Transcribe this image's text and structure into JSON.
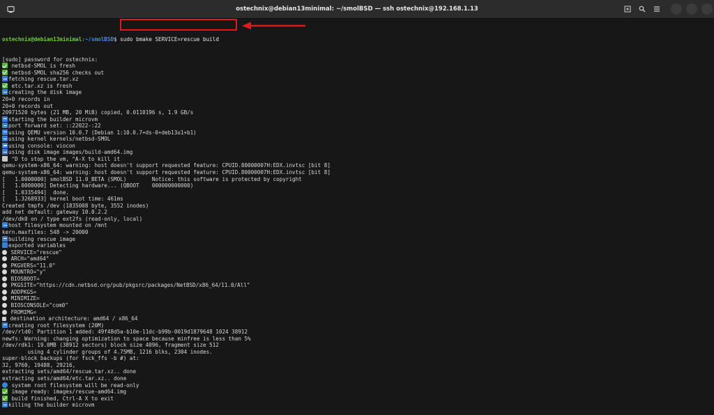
{
  "window": {
    "title": "ostechnix@debian13minimal: ~/smolBSD — ssh ostechnix@192.168.1.13"
  },
  "prompt": {
    "user_host": "ostechnix@debian13minimal",
    "path": ":~/smolBSD",
    "symbol": "$",
    "command": "sudo bmake SERVICE=rescue build"
  },
  "annotation": {
    "color": "#e0191b"
  },
  "lines": [
    {
      "icon": "",
      "text": "[sudo] password for ostechnix:"
    },
    {
      "icon": "check-icon",
      "text": " netbsd-SMOL is fresh"
    },
    {
      "icon": "check-icon",
      "text": " netbsd-SMOL sha256 checks out"
    },
    {
      "icon": "arrow-icon",
      "text": "fetching rescue.tar.xz"
    },
    {
      "icon": "check-icon",
      "text": " etc.tar.xz is fresh"
    },
    {
      "icon": "arrow-icon",
      "text": "creating the disk image"
    },
    {
      "icon": "",
      "text": "20+0 records in"
    },
    {
      "icon": "",
      "text": "20+0 records out"
    },
    {
      "icon": "",
      "text": "20971520 bytes (21 MB, 20 MiB) copied, 0.0110196 s, 1.9 GB/s"
    },
    {
      "icon": "arrow-icon",
      "text": "starting the builder microvm"
    },
    {
      "icon": "arrow-icon",
      "text": "port forward set: ::22022-:22"
    },
    {
      "icon": "arrow-icon",
      "text": "using QEMU version 10.0.7 (Debian 1:10.0.7+ds-0+deb13u1+b1)"
    },
    {
      "icon": "arrow-icon",
      "text": "using kernel kernels/netbsd-SMOL"
    },
    {
      "icon": "arrow-icon",
      "text": "using console: viocon"
    },
    {
      "icon": "arrow-icon",
      "text": "using disk image images/build-amd64.img"
    },
    {
      "icon": "clock-icon",
      "text": " ^D to stop the vm, ^A-X to kill it"
    },
    {
      "icon": "",
      "text": "qemu-system-x86_64: warning: host doesn't support requested feature: CPUID.80000007H:EDX.invtsc [bit 8]"
    },
    {
      "icon": "",
      "text": "qemu-system-x86_64: warning: host doesn't support requested feature: CPUID.80000007H:EDX.invtsc [bit 8]"
    },
    {
      "icon": "",
      "text": "[   1.0000000] smolBSD 11.0_BETA (SMOL)        Notice: this software is protected by copyright"
    },
    {
      "icon": "",
      "text": "[   1.0000000] Detecting hardware... (QBOOT    000000000000)"
    },
    {
      "icon": "",
      "text": "[   1.0335494]  done."
    },
    {
      "icon": "",
      "text": "[   1.3268933] kernel boot time: 461ms"
    },
    {
      "icon": "",
      "text": "Created tmpfs /dev (1835008 byte, 3552 inodes)"
    },
    {
      "icon": "",
      "text": "add net default: gateway 10.0.2.2"
    },
    {
      "icon": "",
      "text": "/dev/dk0 on / type ext2fs (read-only, local)"
    },
    {
      "icon": "arrow-icon",
      "text": "host filesystem mounted on /mnt"
    },
    {
      "icon": "",
      "text": "kern.maxfiles: 548 -> 20000"
    },
    {
      "icon": "arrow-icon",
      "text": "building rescue image"
    },
    {
      "icon": "info-icon",
      "text": "exported variables"
    },
    {
      "icon": "circle-icon",
      "text": " SERVICE=\"rescue\""
    },
    {
      "icon": "circle-icon",
      "text": " ARCH=\"amd64\""
    },
    {
      "icon": "circle-icon",
      "text": " PKGVERS=\"11.0\""
    },
    {
      "icon": "circle-icon",
      "text": " MOUNTRO=\"y\""
    },
    {
      "icon": "circle-icon",
      "text": " BIOSBOOT="
    },
    {
      "icon": "circle-icon",
      "text": " PKGSITE=\"https://cdn.netbsd.org/pub/pkgsrc/packages/NetBSD/x86_64/11.0/All\""
    },
    {
      "icon": "circle-icon",
      "text": " ADDPKGS="
    },
    {
      "icon": "circle-icon",
      "text": " MINIMIZE="
    },
    {
      "icon": "circle-icon",
      "text": " BIOSCONSOLE=\"com0\""
    },
    {
      "icon": "circle-icon",
      "text": " FROMIMG="
    },
    {
      "icon": "square-icon",
      "text": " destination architecture: amd64 / x86_64"
    },
    {
      "icon": "arrow-icon",
      "text": "creating root filesystem (20M)"
    },
    {
      "icon": "",
      "text": "/dev/rld0: Partition 1 added: 49f48d5a-b10e-11dc-b99b-0019d1879648 1024 38912"
    },
    {
      "icon": "",
      "text": "newfs: Warning: changing optimization to space because minfree is less than 5%"
    },
    {
      "icon": "",
      "text": "/dev/rdk1: 19.0MB (38912 sectors) block size 4096, fragment size 512"
    },
    {
      "icon": "",
      "text": "        using 4 cylinder groups of 4.75MB, 1216 blks, 2304 inodes."
    },
    {
      "icon": "",
      "text": "super-block backups (for fsck_ffs -b #) at:"
    },
    {
      "icon": "",
      "text": "32, 9760, 19488, 29216,"
    },
    {
      "icon": "",
      "text": "extracting sets/amd64/rescue.tar.xz.. done"
    },
    {
      "icon": "",
      "text": "extracting sets/amd64/etc.tar.xz.. done"
    },
    {
      "icon": "globe-icon",
      "text": " system root filesystem will be read-only"
    },
    {
      "icon": "check-icon",
      "text": " image ready: images/rescue-amd64.img"
    },
    {
      "icon": "check-icon",
      "text": " build finished, Ctrl-A X to exit"
    },
    {
      "icon": "arrow-icon",
      "text": "killing the builder microvm"
    }
  ]
}
